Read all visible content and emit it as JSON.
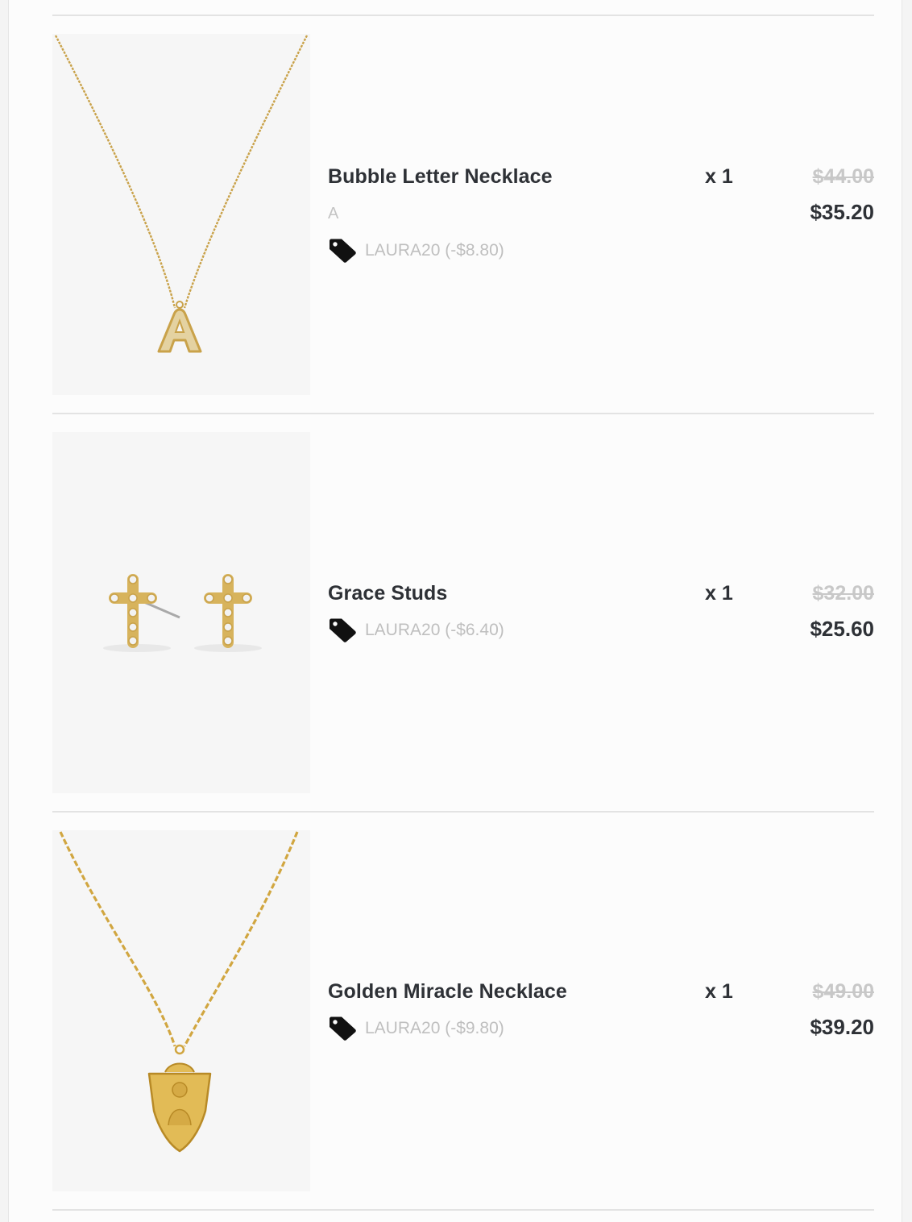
{
  "cart": {
    "items": [
      {
        "name": "Bubble Letter Necklace",
        "variant": "A",
        "quantity": "x 1",
        "original_price": "$44.00",
        "price": "$35.20",
        "discount": "LAURA20 (-$8.80)",
        "image_icon": "bubble-letter-necklace-image"
      },
      {
        "name": "Grace Studs",
        "quantity": "x 1",
        "original_price": "$32.00",
        "price": "$25.60",
        "discount": "LAURA20 (-$6.40)",
        "image_icon": "grace-studs-image"
      },
      {
        "name": "Golden Miracle Necklace",
        "quantity": "x 1",
        "original_price": "$49.00",
        "price": "$39.20",
        "discount": "LAURA20 (-$9.80)",
        "image_icon": "golden-miracle-necklace-image"
      }
    ]
  },
  "colors": {
    "text_primary": "#2e3136",
    "text_muted": "#c4c4c4",
    "gold": "#c9a24a",
    "divider": "#e3e3e3"
  }
}
